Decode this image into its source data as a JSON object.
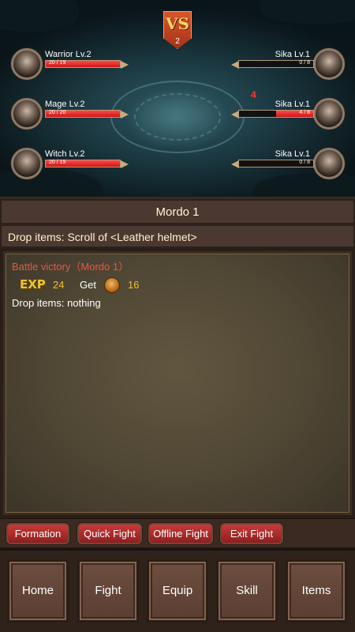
{
  "battle": {
    "round": "2",
    "vs_label": "VS",
    "damage_popup": "4",
    "allies": [
      {
        "name": "Warrior Lv.2",
        "hp": "20 / 19",
        "hp_fraction": 1.0,
        "portrait_icon": "warrior-portrait-icon"
      },
      {
        "name": "Mage Lv.2",
        "hp": "20 / 20",
        "hp_fraction": 1.0,
        "portrait_icon": "mage-portrait-icon"
      },
      {
        "name": "Witch Lv.2",
        "hp": "20 / 19",
        "hp_fraction": 1.0,
        "portrait_icon": "witch-portrait-icon"
      }
    ],
    "enemies": [
      {
        "name": "Sika Lv.1",
        "hp": "0 / 8",
        "hp_fraction": 0.0,
        "portrait_icon": "sika-portrait-icon"
      },
      {
        "name": "Sika Lv.1",
        "hp": "4 / 8",
        "hp_fraction": 0.5,
        "portrait_icon": "sika-portrait-icon"
      },
      {
        "name": "Sika Lv.1",
        "hp": "0 / 8",
        "hp_fraction": 0.0,
        "portrait_icon": "sika-portrait-icon"
      }
    ]
  },
  "stage": {
    "title": "Mordo 1",
    "drop_items": "Drop items: Scroll of <Leather helmet>"
  },
  "log": {
    "result": "Battle victory（Mordo 1）",
    "exp_label": "EXP",
    "exp_value": "24",
    "get_label": "Get",
    "coin_icon": "gold-coin-icon",
    "coin_value": "16",
    "drop_line": "Drop items: nothing"
  },
  "actions": {
    "formation": "Formation",
    "quick_fight": "Quick Fight",
    "offline_fight": "Offline Fight",
    "exit_fight": "Exit Fight"
  },
  "nav": {
    "home": "Home",
    "fight": "Fight",
    "equip": "Equip",
    "skill": "Skill",
    "items": "Items"
  },
  "colors": {
    "hp_bar": "#e02020",
    "button_red": "#b02a2a",
    "exp_gold": "#f2c230",
    "log_title_red": "#e05a4a"
  }
}
